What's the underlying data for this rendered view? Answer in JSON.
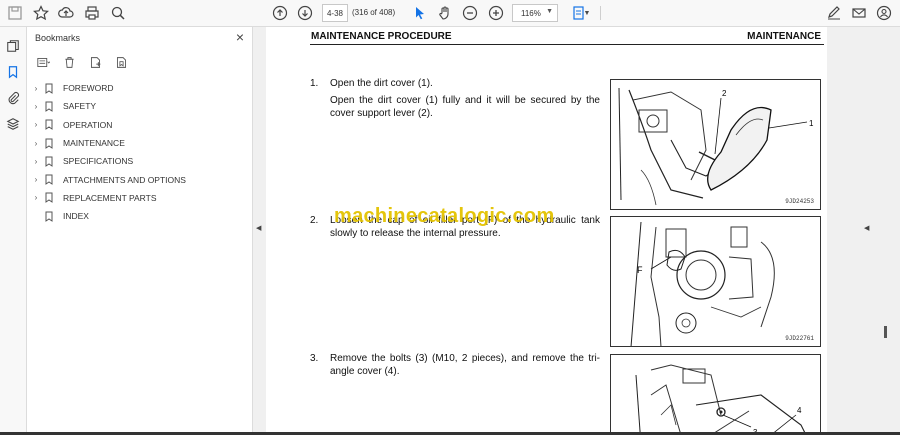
{
  "toolbar": {
    "page_input": "4-38",
    "page_count": "(316 of 408)",
    "zoom": "116%"
  },
  "rail": {
    "icons": [
      "pages-icon",
      "bookmark-icon",
      "attachment-icon",
      "layers-icon"
    ]
  },
  "bookmarks": {
    "title": "Bookmarks",
    "items": [
      {
        "label": "FOREWORD",
        "expandable": true
      },
      {
        "label": "SAFETY",
        "expandable": true
      },
      {
        "label": "OPERATION",
        "expandable": true
      },
      {
        "label": "MAINTENANCE",
        "expandable": true
      },
      {
        "label": "SPECIFICATIONS",
        "expandable": true
      },
      {
        "label": "ATTACHMENTS AND OPTIONS",
        "expandable": true
      },
      {
        "label": "REPLACEMENT PARTS",
        "expandable": true
      },
      {
        "label": "INDEX",
        "expandable": false
      }
    ]
  },
  "document": {
    "header_left": "MAINTENANCE PROCEDURE",
    "header_right": "MAINTENANCE",
    "steps": [
      {
        "num": "1.",
        "lines": [
          "Open the dirt cover (1).",
          "Open the dirt cover (1) fully and it will be secured by the cover support lever (2)."
        ]
      },
      {
        "num": "2.",
        "lines": [
          "Loosen the cap of oil filler port (F) of the hydraulic tank slowly to release the internal pressure."
        ]
      },
      {
        "num": "3.",
        "lines": [
          "Remove the bolts (3) (M10, 2 pieces), and remove the tri-angle cover (4)."
        ]
      }
    ],
    "figures": [
      {
        "code": "9JD24253",
        "callouts": [
          "2",
          "1"
        ]
      },
      {
        "code": "9JD22761",
        "callouts": [
          "F"
        ]
      },
      {
        "code": "",
        "callouts": [
          "3",
          "4"
        ]
      }
    ],
    "watermark": "machinecatalogic.com"
  }
}
